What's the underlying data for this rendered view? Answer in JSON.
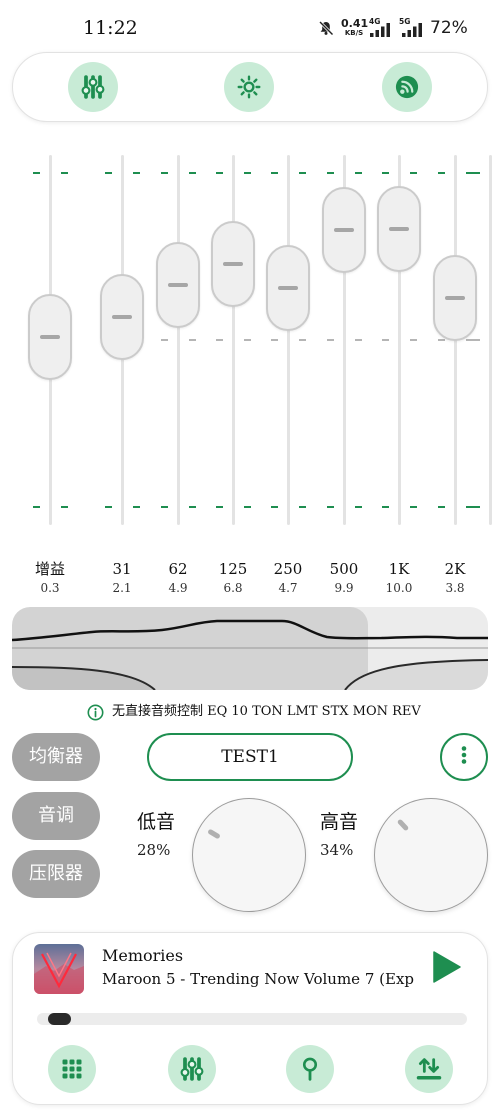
{
  "status_bar": {
    "time": "11:22",
    "net_speed_value": "0.41",
    "net_speed_unit": "KB/S",
    "net_type_1": "4G",
    "net_type_2": "5G",
    "battery": "72%",
    "icons": [
      "mute-icon",
      "signal-icon",
      "signal-icon"
    ]
  },
  "top_bar": {
    "buttons": [
      "equalizer-icon",
      "brightness-icon",
      "surround-icon"
    ]
  },
  "equalizer": {
    "scale": [
      -15,
      15
    ],
    "bands": [
      {
        "label": "增益",
        "value": "0.3"
      },
      {
        "label": "31",
        "value": "2.1"
      },
      {
        "label": "62",
        "value": "4.9"
      },
      {
        "label": "125",
        "value": "6.8"
      },
      {
        "label": "250",
        "value": "4.7"
      },
      {
        "label": "500",
        "value": "9.9"
      },
      {
        "label": "1K",
        "value": "10.0"
      },
      {
        "label": "2K",
        "value": "3.8"
      }
    ]
  },
  "info": {
    "icon": "info-icon",
    "text": "无直接音频控制 EQ 10 TON LMT STX MON REV"
  },
  "modes": [
    {
      "label": "均衡器"
    },
    {
      "label": "音调"
    },
    {
      "label": "压限器"
    }
  ],
  "preset": {
    "name": "TEST1",
    "menu_icon": "more-vertical-icon"
  },
  "tone": {
    "bass": {
      "label": "低音",
      "value": "28%"
    },
    "treble": {
      "label": "高音",
      "value": "34%"
    }
  },
  "player": {
    "title": "Memories",
    "subtitle": "Maroon 5 - Trending Now Volume 7 (Exp···",
    "progress": 0,
    "play_icon": "play-icon"
  },
  "bottom_nav": {
    "buttons": [
      "apps-grid-icon",
      "equalizer-icon",
      "magnifier-icon",
      "import-export-icon"
    ]
  },
  "colors": {
    "accent": "#1e8e50",
    "accent_light": "#c8ebd6",
    "mode_button": "#a3a3a3"
  }
}
